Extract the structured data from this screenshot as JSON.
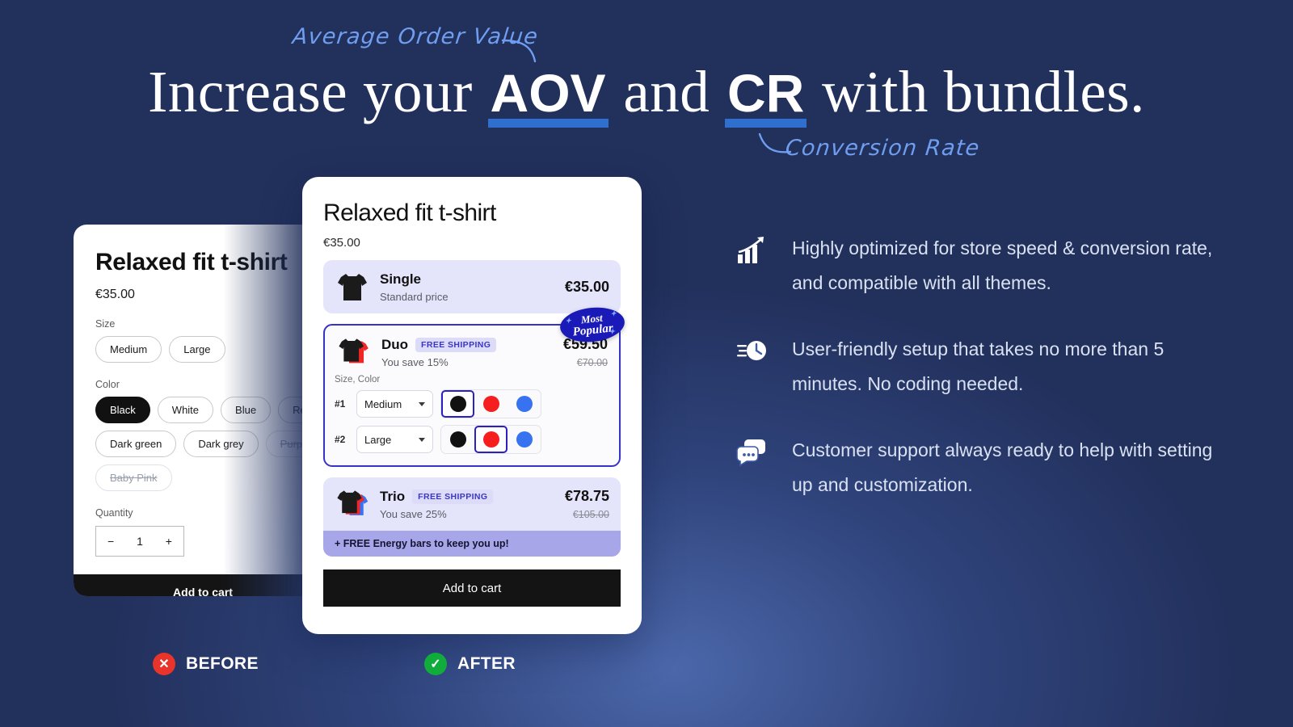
{
  "background": {
    "base_color": "#22305c",
    "glow_color": "#4a6fc4"
  },
  "headline": {
    "part1": "Increase your ",
    "em1": "AOV",
    "part2": " and ",
    "em2": "CR",
    "part3": " with bundles.",
    "underline_color": "#2f6fd0"
  },
  "annotations": {
    "aov": "Average Order Value",
    "cr": "Conversion Rate",
    "color": "#6f9ef0"
  },
  "before_card": {
    "title": "Relaxed fit t-shirt",
    "price": "€35.00",
    "size_label": "Size",
    "sizes": [
      "Medium",
      "Large"
    ],
    "color_label": "Color",
    "colors": [
      {
        "label": "Black",
        "state": "selected"
      },
      {
        "label": "White",
        "state": "available"
      },
      {
        "label": "Blue",
        "state": "available"
      },
      {
        "label": "Red",
        "state": "available"
      },
      {
        "label": "Dark green",
        "state": "available"
      },
      {
        "label": "Dark grey",
        "state": "available"
      },
      {
        "label": "Purple",
        "state": "unavailable"
      },
      {
        "label": "Baby Pink",
        "state": "unavailable"
      }
    ],
    "quantity_label": "Quantity",
    "quantity_minus": "−",
    "quantity_value": "1",
    "quantity_plus": "+",
    "add_to_cart": "Add to cart"
  },
  "after_card": {
    "title": "Relaxed fit t-shirt",
    "price": "€35.00",
    "options": [
      {
        "name": "Single",
        "subtitle": "Standard price",
        "price": "€35.00",
        "compare_at": "",
        "badge": "",
        "selected": false
      },
      {
        "name": "Duo",
        "subtitle": "You save 15%",
        "price": "€59.50",
        "compare_at": "€70.00",
        "badge": "FREE SHIPPING",
        "selected": true
      },
      {
        "name": "Trio",
        "subtitle": "You save 25%",
        "price": "€78.75",
        "compare_at": "€105.00",
        "badge": "FREE SHIPPING",
        "selected": false
      }
    ],
    "most_popular": {
      "line1": "Most",
      "line2": "Popular"
    },
    "variants_label": "Size, Color",
    "variant_rows": [
      {
        "num": "#1",
        "size": "Medium",
        "selected_color": "black"
      },
      {
        "num": "#2",
        "size": "Large",
        "selected_color": "red"
      }
    ],
    "swatch_colors": [
      "#111111",
      "#f51f1f",
      "#3773f0"
    ],
    "trio_banner": "+ FREE Energy bars to keep you up!",
    "add_to_cart": "Add to cart"
  },
  "features": [
    {
      "icon": "growth-chart-icon",
      "text": "Highly optimized for store speed & conversion rate, and compatible with all themes."
    },
    {
      "icon": "fast-clock-icon",
      "text": "User-friendly setup that takes no more than 5 minutes. No coding needed."
    },
    {
      "icon": "chat-bubbles-icon",
      "text": "Customer support always ready to help with setting up and customization."
    }
  ],
  "legend": {
    "before": {
      "label": "BEFORE",
      "color": "#e8342a",
      "glyph": "✕"
    },
    "after": {
      "label": "AFTER",
      "color": "#11ad3c",
      "glyph": "✓"
    }
  }
}
